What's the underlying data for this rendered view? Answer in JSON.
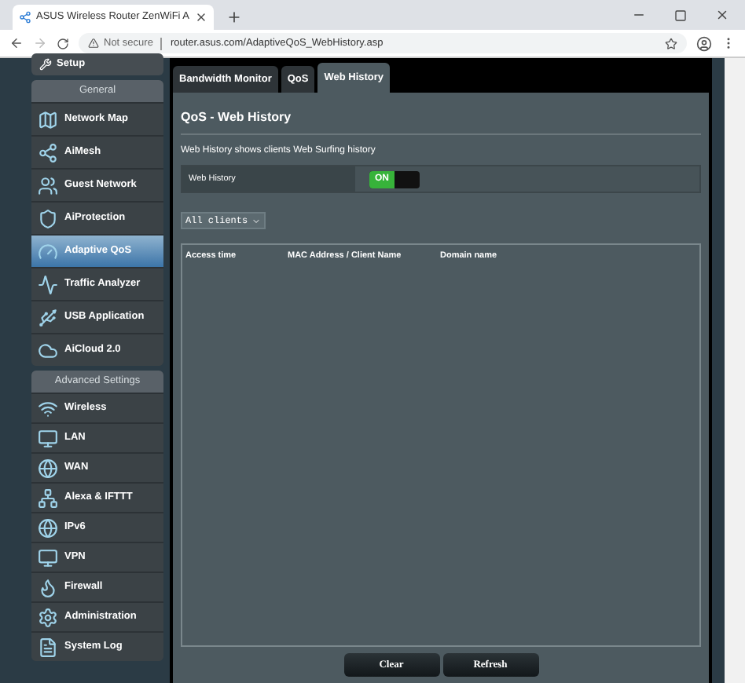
{
  "browser": {
    "tab_title": "ASUS Wireless Router ZenWiFi A",
    "security": "Not secure",
    "url": "router.asus.com/AdaptiveQoS_WebHistory.asp"
  },
  "sidebar": {
    "top_item": "Setup",
    "sections": [
      {
        "title": "General",
        "items": [
          {
            "label": "Network Map",
            "selected": false
          },
          {
            "label": "AiMesh",
            "selected": false
          },
          {
            "label": "Guest Network",
            "selected": false
          },
          {
            "label": "AiProtection",
            "selected": false
          },
          {
            "label": "Adaptive QoS",
            "selected": true
          },
          {
            "label": "Traffic Analyzer",
            "selected": false
          },
          {
            "label": "USB Application",
            "selected": false
          },
          {
            "label": "AiCloud 2.0",
            "selected": false
          }
        ]
      },
      {
        "title": "Advanced Settings",
        "items": [
          {
            "label": "Wireless",
            "selected": false
          },
          {
            "label": "LAN",
            "selected": false
          },
          {
            "label": "WAN",
            "selected": false
          },
          {
            "label": "Alexa & IFTTT",
            "selected": false
          },
          {
            "label": "IPv6",
            "selected": false
          },
          {
            "label": "VPN",
            "selected": false
          },
          {
            "label": "Firewall",
            "selected": false
          },
          {
            "label": "Administration",
            "selected": false
          },
          {
            "label": "System Log",
            "selected": false
          }
        ]
      }
    ]
  },
  "tabs": [
    {
      "label": "Bandwidth Monitor",
      "selected": false
    },
    {
      "label": "QoS",
      "selected": false
    },
    {
      "label": "Web History",
      "selected": true
    }
  ],
  "content": {
    "title": "QoS - Web History",
    "description": "Web History shows clients Web Surfing history",
    "setting": {
      "label": "Web History",
      "value": "ON",
      "on": true
    },
    "filter": "All clients",
    "table": {
      "columns": [
        "Access time",
        "MAC Address / Client Name",
        "Domain name"
      ]
    },
    "buttons": [
      "Clear",
      "Refresh"
    ]
  }
}
